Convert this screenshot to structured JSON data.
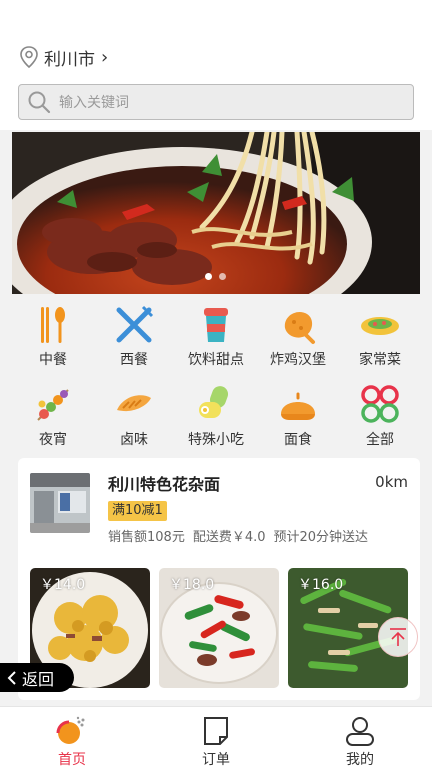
{
  "header": {
    "city": "利川市",
    "search_placeholder": "输入关键词"
  },
  "banner": {
    "slides": 2,
    "active_slide": 1
  },
  "categories": [
    {
      "label": "中餐",
      "icon": "chopsticks-spoon-icon"
    },
    {
      "label": "西餐",
      "icon": "fork-knife-icon"
    },
    {
      "label": "饮料甜点",
      "icon": "drink-cup-icon"
    },
    {
      "label": "炸鸡汉堡",
      "icon": "fried-chicken-icon"
    },
    {
      "label": "家常菜",
      "icon": "home-dish-icon"
    },
    {
      "label": "夜宵",
      "icon": "skewer-icon"
    },
    {
      "label": "卤味",
      "icon": "braised-meat-icon"
    },
    {
      "label": "特殊小吃",
      "icon": "snack-roll-icon"
    },
    {
      "label": "面食",
      "icon": "bun-icon"
    },
    {
      "label": "全部",
      "icon": "four-leaf-icon"
    }
  ],
  "shop": {
    "name": "利川特色花杂面",
    "distance": "0km",
    "promo": "满10减1",
    "sales": "销售额108元",
    "delivery_fee": "配送费￥4.0",
    "eta": "预计20分钟送达",
    "dishes": [
      {
        "price": "￥14.0"
      },
      {
        "price": "￥18.0"
      },
      {
        "price": "￥16.0"
      }
    ]
  },
  "back_button": {
    "label": "返回"
  },
  "tabbar": {
    "items": [
      {
        "label": "首页",
        "icon": "home-fruit-icon",
        "active": true
      },
      {
        "label": "订单",
        "icon": "order-note-icon",
        "active": false
      },
      {
        "label": "我的",
        "icon": "user-profile-icon",
        "active": false
      }
    ]
  },
  "colors": {
    "accent": "#e8334a",
    "promo_bg": "#f5c447",
    "page_bg": "#f2f2f2"
  }
}
